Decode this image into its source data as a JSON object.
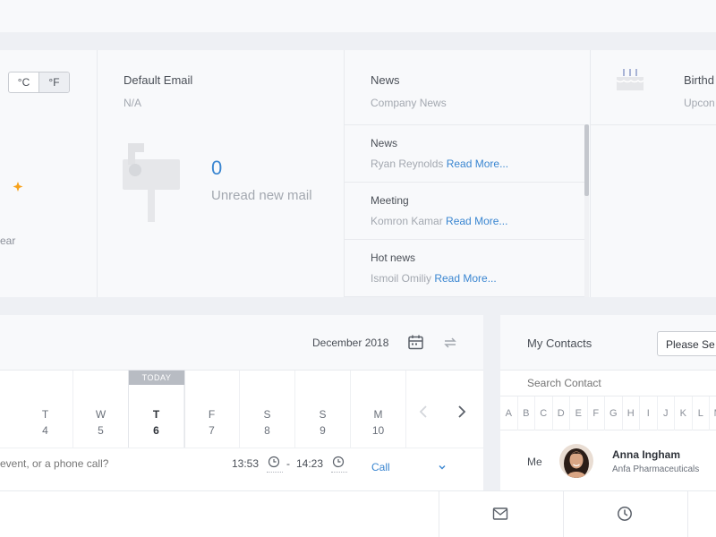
{
  "weather": {
    "unit_c": "°C",
    "unit_f": "°F",
    "condition": "ear"
  },
  "email": {
    "title": "Default Email",
    "address": "N/A",
    "unread_count": "0",
    "unread_label": "Unread new mail"
  },
  "news": {
    "title": "News",
    "subtitle": "Company News",
    "items": [
      {
        "category": "News",
        "author": "Ryan Reynolds",
        "link": "Read More..."
      },
      {
        "category": "Meeting",
        "author": "Komron Kamar",
        "link": "Read More..."
      },
      {
        "category": "Hot news",
        "author": "Ismoil Omiliy",
        "link": "Read More..."
      }
    ]
  },
  "birthday": {
    "title": "Birthd",
    "subtitle": "Upcon"
  },
  "calendar": {
    "month": "December 2018",
    "today_label": "TODAY",
    "days": [
      {
        "letter": "T",
        "num": "4"
      },
      {
        "letter": "W",
        "num": "5"
      },
      {
        "letter": "T",
        "num": "6"
      },
      {
        "letter": "F",
        "num": "7"
      },
      {
        "letter": "S",
        "num": "8"
      },
      {
        "letter": "S",
        "num": "9"
      },
      {
        "letter": "M",
        "num": "10"
      }
    ],
    "event_placeholder": "event, or a phone call?",
    "time_start": "13:53",
    "time_sep": "-",
    "time_end": "14:23",
    "event_type": "Call"
  },
  "contacts": {
    "title": "My Contacts",
    "select_value": "Please Se",
    "search_placeholder": "Search Contact",
    "alphabet": [
      "A",
      "B",
      "C",
      "D",
      "E",
      "F",
      "G",
      "H",
      "I",
      "J",
      "K",
      "L",
      "M"
    ],
    "me_label": "Me",
    "me_name": "Anna Ingham",
    "me_company": "Anfa Pharmaceuticals"
  },
  "colors": {
    "accent": "#3a86d1",
    "moon": "#f7a21b"
  }
}
